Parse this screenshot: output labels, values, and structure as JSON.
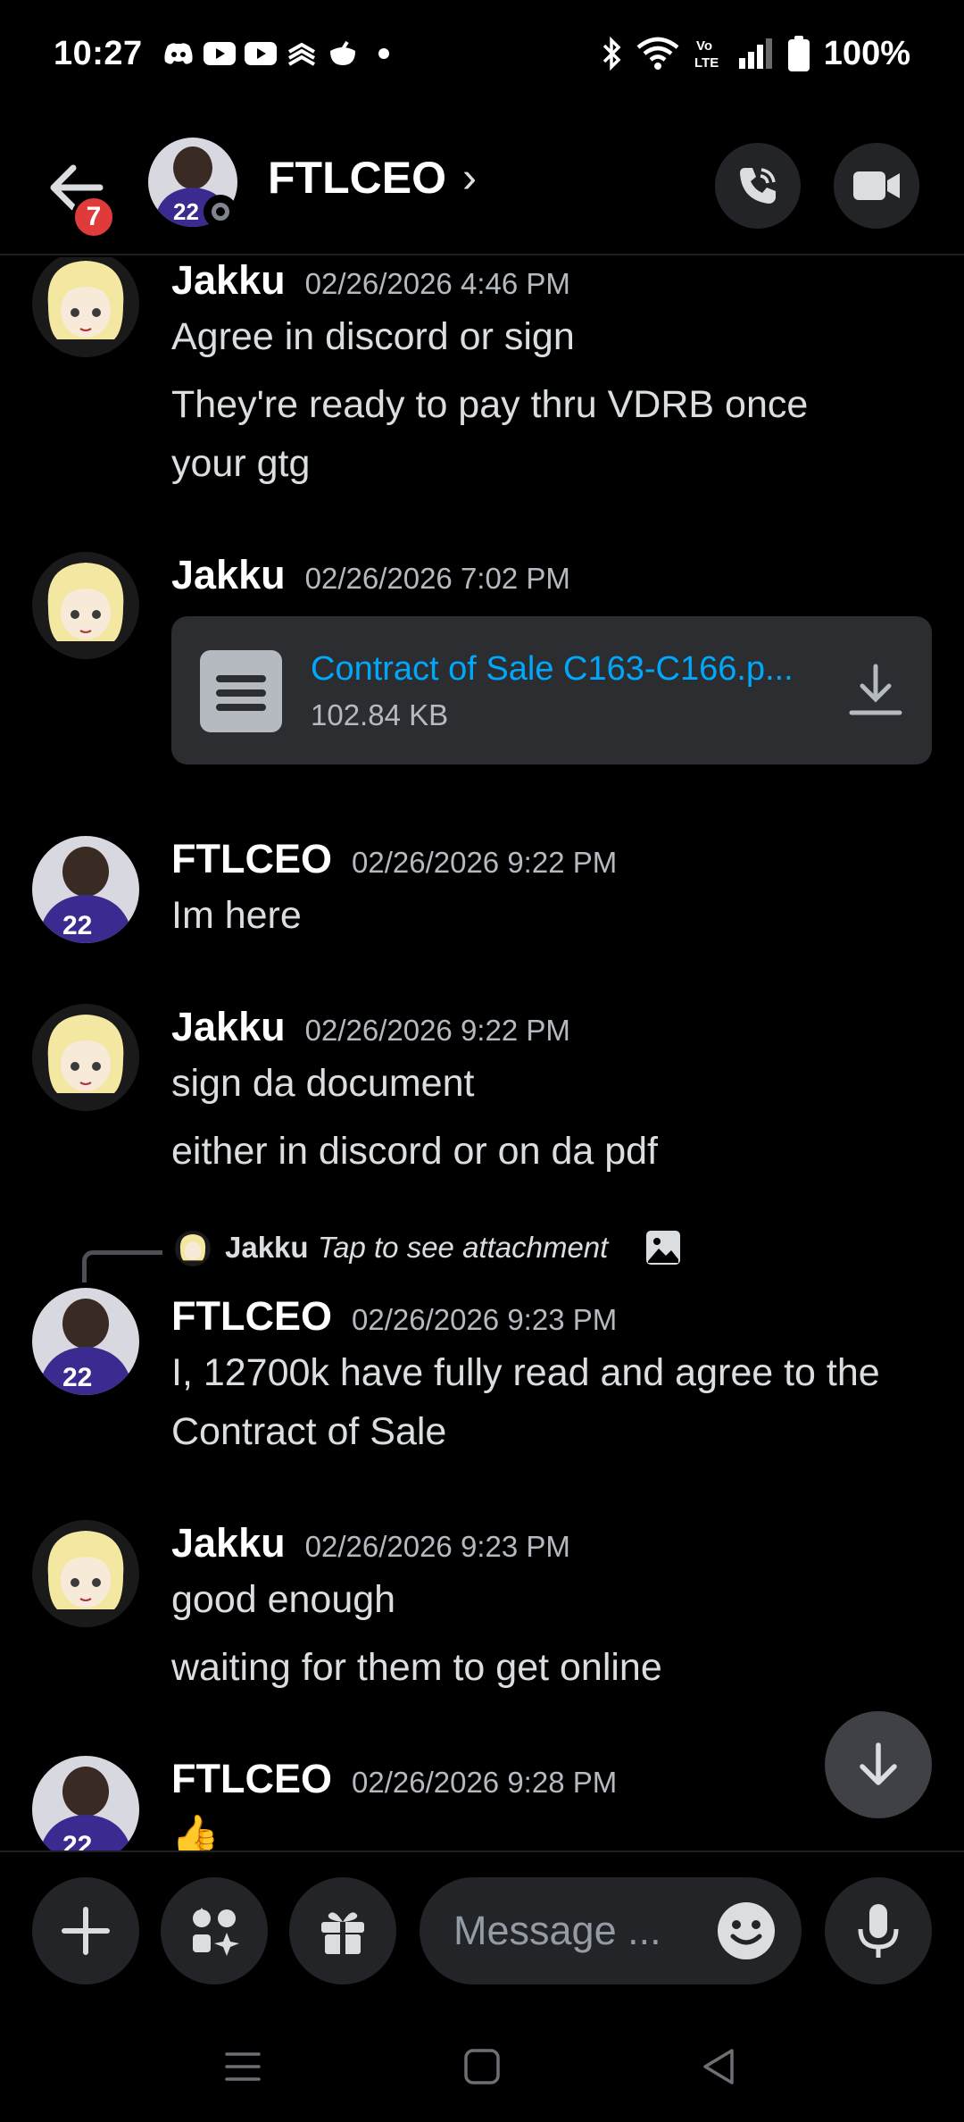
{
  "status_bar": {
    "time": "10:27",
    "notification_icons": [
      "discord-icon",
      "youtube-icon",
      "youtube-icon",
      "layers-icon",
      "gas-icon",
      "dot-icon"
    ],
    "system_icons": [
      "bluetooth-icon",
      "wifi-icon",
      "volte-icon",
      "signal-icon",
      "battery-icon"
    ],
    "battery": "100%"
  },
  "header": {
    "badge_count": "7",
    "title": "FTLCEO",
    "chevron": "›",
    "avatar_number": "22"
  },
  "messages": [
    {
      "author": "Jakku",
      "timestamp": "02/26/2026 4:46 PM",
      "lines": [
        "Agree in discord or sign",
        "They're ready to pay thru VDRB once",
        "your gtg"
      ]
    },
    {
      "author": "Jakku",
      "timestamp": "02/26/2026 7:02 PM",
      "attachment": {
        "name": "Contract of Sale C163-C166.p...",
        "size": "102.84 KB"
      }
    },
    {
      "author": "FTLCEO",
      "timestamp": "02/26/2026 9:22 PM",
      "lines": [
        "Im here"
      ]
    },
    {
      "author": "Jakku",
      "timestamp": "02/26/2026 9:22 PM",
      "lines": [
        "sign da document",
        "either in discord or on da pdf"
      ]
    },
    {
      "reply": {
        "author": "Jakku",
        "text": "Tap to see attachment"
      },
      "author": "FTLCEO",
      "timestamp": "02/26/2026 9:23 PM",
      "lines": [
        "I, 12700k have fully read and agree to the",
        "Contract of Sale"
      ]
    },
    {
      "author": "Jakku",
      "timestamp": "02/26/2026 9:23 PM",
      "lines": [
        "good enough",
        "waiting for them to get online"
      ]
    },
    {
      "author": "FTLCEO",
      "timestamp": "02/26/2026 9:28 PM",
      "lines": [
        "👍"
      ]
    }
  ],
  "input": {
    "placeholder": "Message ..."
  },
  "colors": {
    "background": "#000000",
    "surface": "#232428",
    "attachment_bg": "#2b2d31",
    "link": "#00a8fc",
    "badge": "#e03b3b",
    "jersey": "#3b2a8f",
    "anime_hair": "#f4e7a1"
  }
}
